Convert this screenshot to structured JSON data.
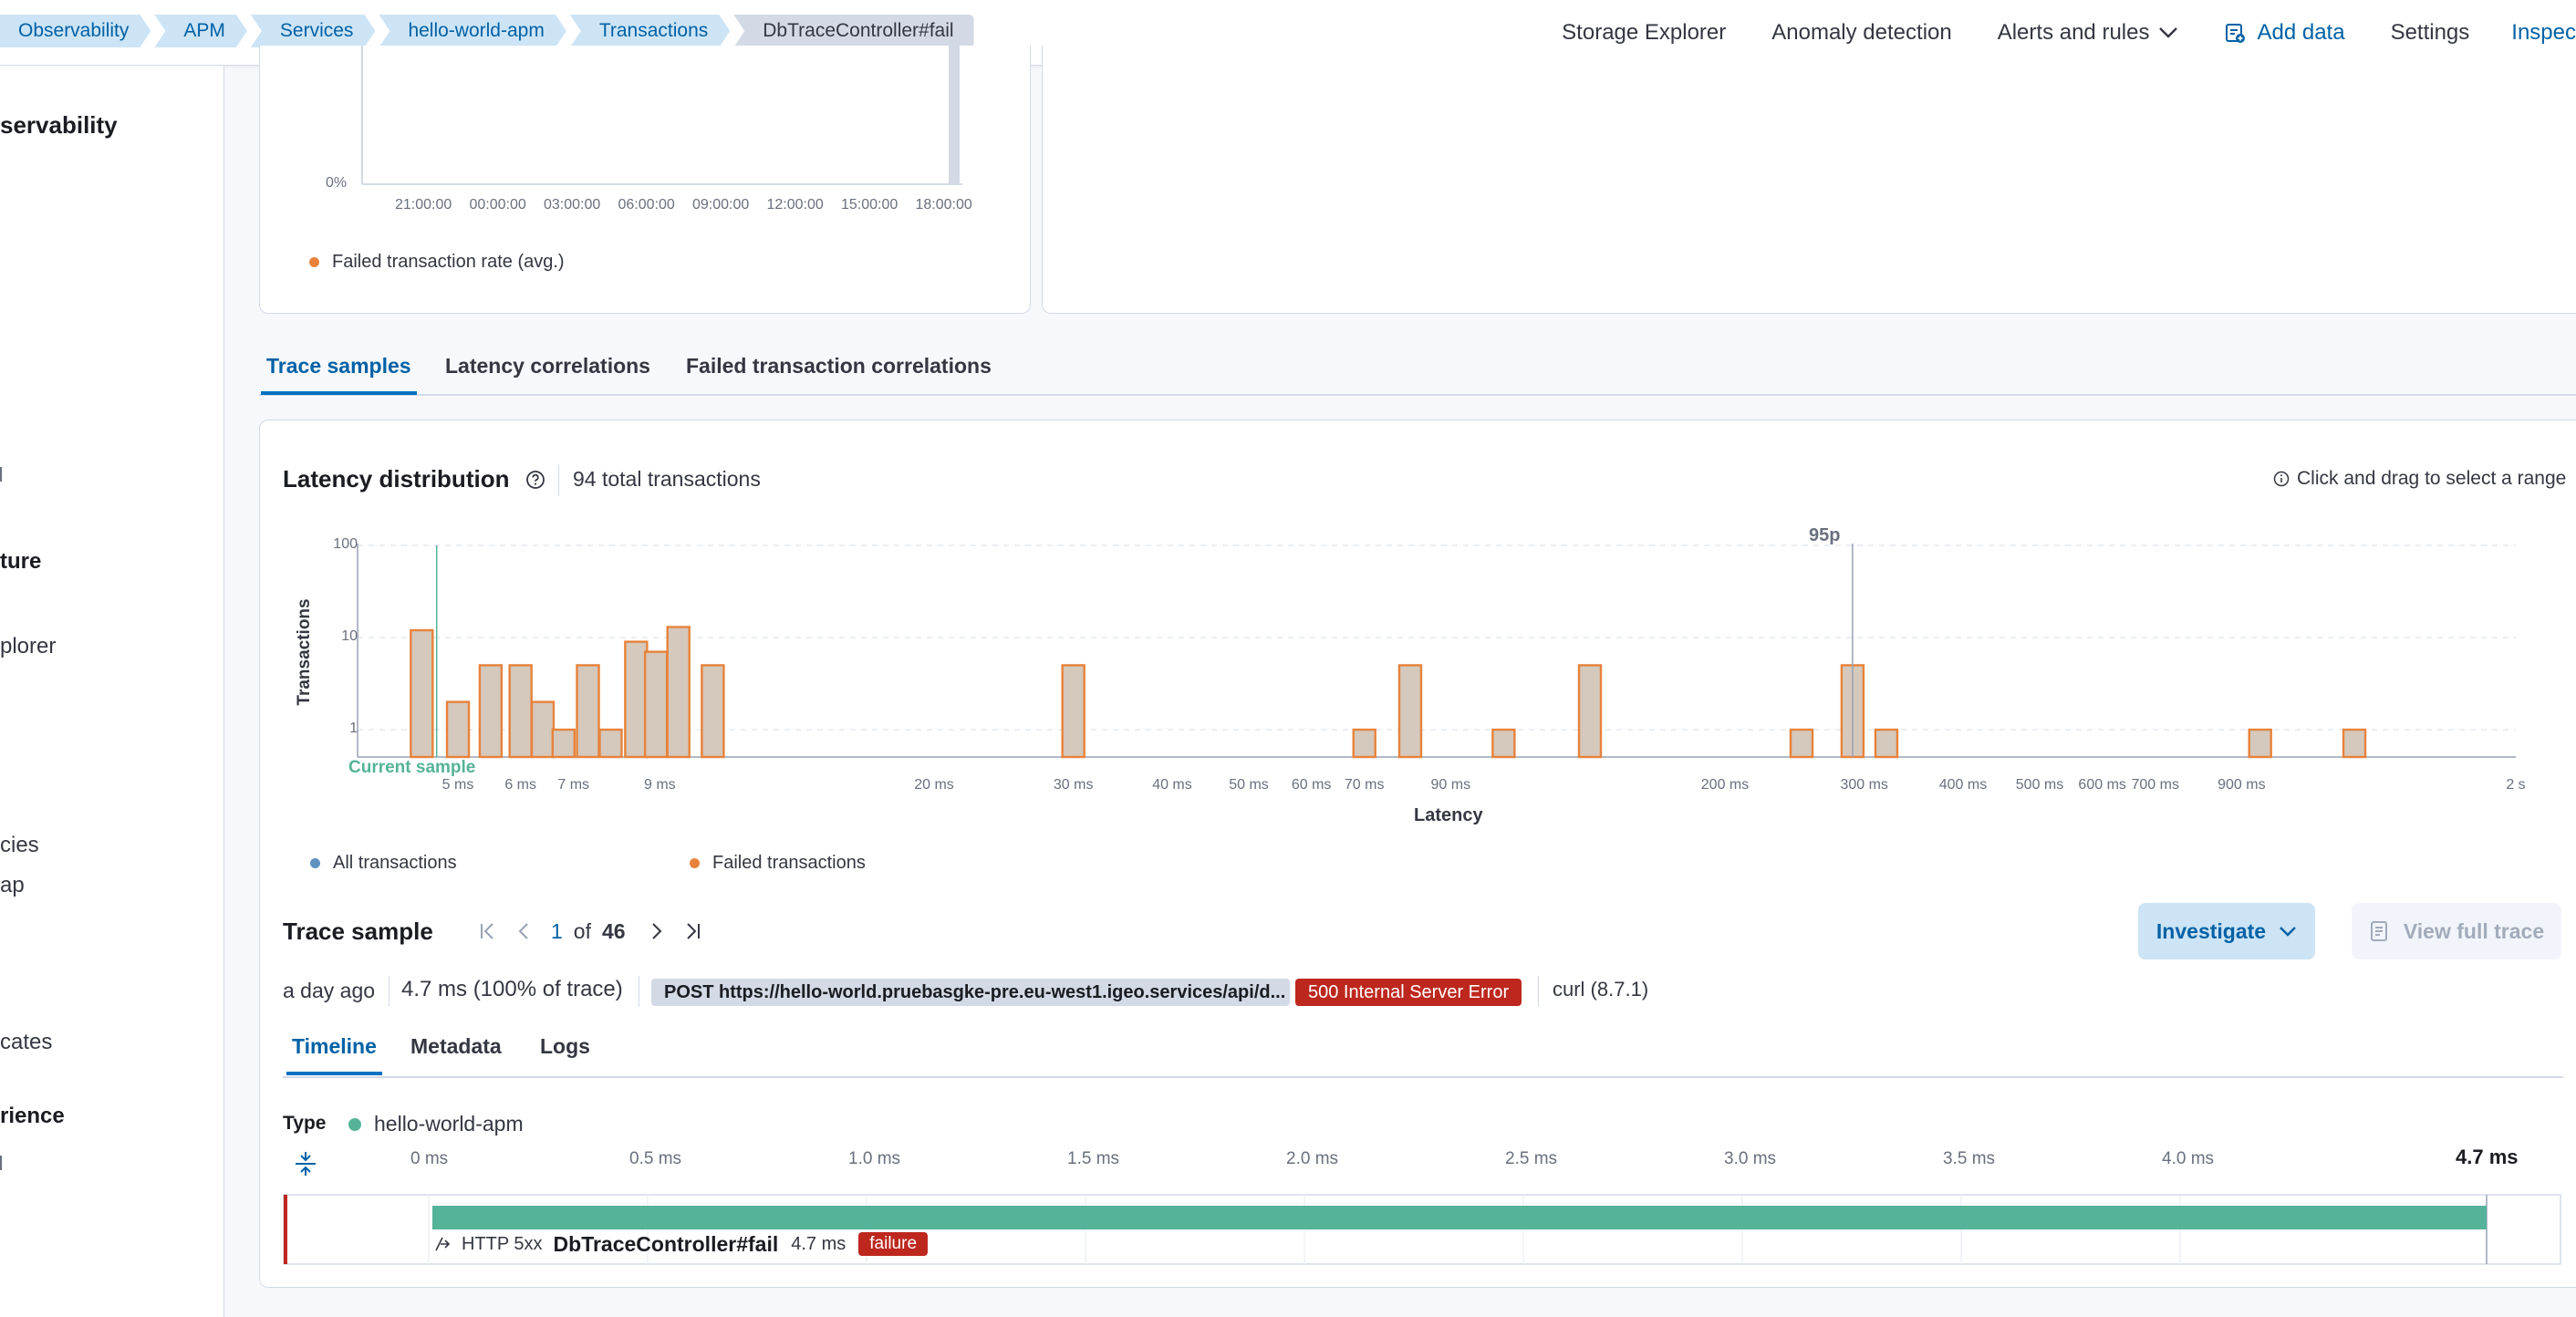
{
  "breadcrumbs": [
    "Observability",
    "APM",
    "Services",
    "hello-world-apm",
    "Transactions",
    "DbTraceController#fail"
  ],
  "header_nav": {
    "storage_explorer": "Storage Explorer",
    "anomaly_detection": "Anomaly detection",
    "alerts_and_rules": "Alerts and rules",
    "add_data": "Add data",
    "settings": "Settings",
    "inspect": "Inspec"
  },
  "sidebar": {
    "title": "servability",
    "items": [
      "ture",
      "plorer",
      "cies",
      "ap",
      "cates",
      "rience"
    ]
  },
  "failed_rate_chart": {
    "y_tick": "0%",
    "x_ticks": [
      "21:00:00",
      "00:00:00",
      "03:00:00",
      "06:00:00",
      "09:00:00",
      "12:00:00",
      "15:00:00",
      "18:00:00"
    ],
    "legend": "Failed transaction rate (avg.)"
  },
  "tabs": [
    "Trace samples",
    "Latency correlations",
    "Failed transaction correlations"
  ],
  "latency": {
    "title": "Latency distribution",
    "total": "94 total transactions",
    "hint": "Click and drag to select a range",
    "marker_95p": "95p",
    "current_sample": "Current sample",
    "legend_all": "All transactions",
    "legend_failed": "Failed transactions"
  },
  "chart_data": {
    "type": "area",
    "title": "Latency distribution",
    "xlabel": "Latency",
    "ylabel": "Transactions",
    "y_scale": "log",
    "y_ticks": [
      "100",
      "10",
      "1"
    ],
    "x_ticks": [
      "5 ms",
      "6 ms",
      "7 ms",
      "9 ms",
      "20 ms",
      "30 ms",
      "40 ms",
      "50 ms",
      "60 ms",
      "70 ms",
      "90 ms",
      "200 ms",
      "300 ms",
      "400 ms",
      "500 ms",
      "600 ms",
      "700 ms",
      "900 ms",
      "2 s"
    ],
    "series": [
      {
        "name": "Failed transactions",
        "color": "#e7823a",
        "points": [
          [
            4.5,
            12
          ],
          [
            5.0,
            2
          ],
          [
            5.5,
            5
          ],
          [
            6.0,
            5
          ],
          [
            6.4,
            2
          ],
          [
            6.8,
            1
          ],
          [
            7.3,
            5
          ],
          [
            7.8,
            1
          ],
          [
            8.4,
            9
          ],
          [
            8.9,
            7
          ],
          [
            9.5,
            13
          ],
          [
            10.5,
            5
          ],
          [
            30,
            5
          ],
          [
            70,
            1
          ],
          [
            80,
            5
          ],
          [
            105,
            1
          ],
          [
            135,
            5
          ],
          [
            250,
            1
          ],
          [
            290,
            5
          ],
          [
            320,
            1
          ],
          [
            950,
            1
          ],
          [
            1250,
            1
          ]
        ]
      }
    ]
  },
  "trace_sample": {
    "title": "Trace sample",
    "current": "1",
    "of_label": "of",
    "total": "46",
    "investigate": "Investigate",
    "view_full_trace": "View full trace",
    "age": "a day ago",
    "duration": "4.7 ms (100% of trace)",
    "request": "POST https://hello-world.pruebasgke-pre.eu-west1.igeo.services/api/d...",
    "status": "500 Internal Server Error",
    "user_agent": "curl (8.7.1)"
  },
  "subtabs": [
    "Timeline",
    "Metadata",
    "Logs"
  ],
  "timeline": {
    "type_label": "Type",
    "service": "hello-world-apm",
    "service_color": "#54b399",
    "ticks": [
      "0 ms",
      "0.5 ms",
      "1.0 ms",
      "1.5 ms",
      "2.0 ms",
      "2.5 ms",
      "3.0 ms",
      "3.5 ms",
      "4.0 ms"
    ],
    "end": "4.7 ms",
    "span_type": "HTTP 5xx",
    "span_name": "DbTraceController#fail",
    "span_duration": "4.7 ms",
    "span_badge": "failure"
  }
}
